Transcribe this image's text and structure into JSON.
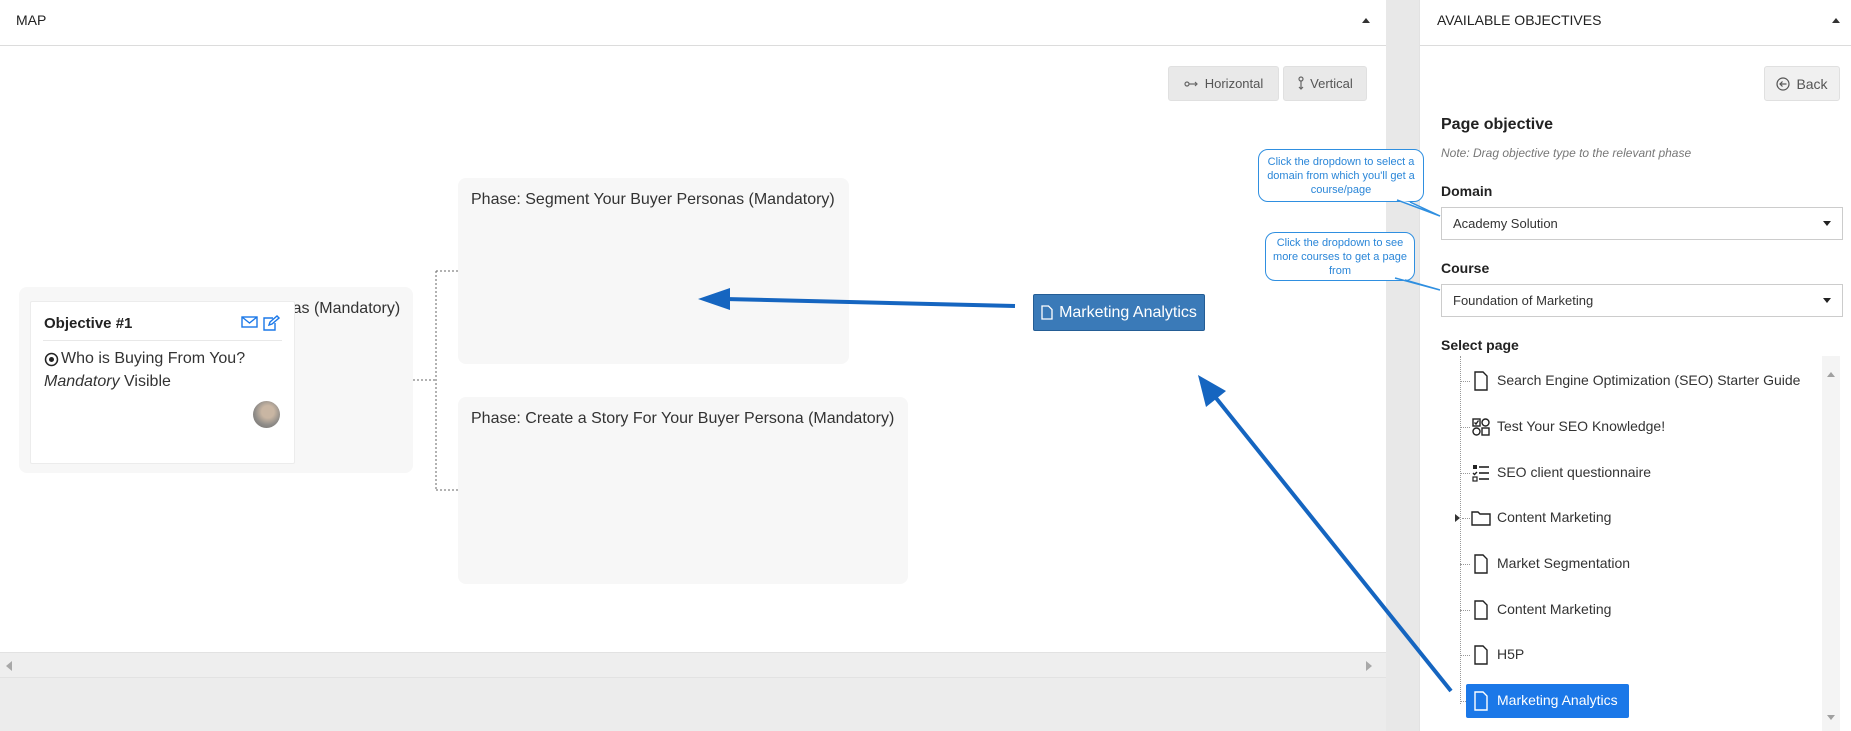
{
  "map": {
    "title": "MAP",
    "buttons": {
      "horizontal": "Horizontal",
      "vertical": "Vertical"
    },
    "phases": [
      {
        "label": "Phase: Research Your Buyer Personas (Mandatory)"
      },
      {
        "label": "Phase: Segment Your Buyer Personas (Mandatory)"
      },
      {
        "label": "Phase: Create a Story For Your Buyer Persona (Mandatory)"
      }
    ],
    "objective": {
      "title": "Objective #1",
      "question": "Who is Buying From You?",
      "mandatory": "Mandatory",
      "visibility": "Visible"
    },
    "drag_chip": "Marketing Analytics"
  },
  "objectives_panel": {
    "title": "AVAILABLE OBJECTIVES",
    "back_label": "Back",
    "page_objective": "Page objective",
    "note": "Note: Drag objective type to the relevant phase",
    "domain_label": "Domain",
    "domain_value": "Academy Solution",
    "course_label": "Course",
    "course_value": "Foundation of Marketing",
    "select_page_label": "Select page",
    "pages": [
      {
        "label": "Search Engine Optimization (SEO) Starter Guide",
        "icon": "file-icon"
      },
      {
        "label": "Test Your SEO Knowledge!",
        "icon": "quiz-icon"
      },
      {
        "label": "SEO client questionnaire",
        "icon": "checklist-icon"
      },
      {
        "label": "Content Marketing",
        "icon": "folder-icon"
      },
      {
        "label": "Market Segmentation",
        "icon": "file-icon"
      },
      {
        "label": "Content Marketing",
        "icon": "file-icon"
      },
      {
        "label": "H5P",
        "icon": "file-icon"
      },
      {
        "label": "Marketing Analytics",
        "icon": "file-icon",
        "selected": true
      }
    ]
  },
  "callouts": {
    "domain": "Click the dropdown to select a domain from which you'll get a course/page",
    "course": "Click the dropdown to see more courses to get a page from"
  },
  "colors": {
    "accent": "#1b78e8",
    "chip": "#3a7ab8",
    "annotation": "#1565c0",
    "callout": "#2a86d8"
  }
}
